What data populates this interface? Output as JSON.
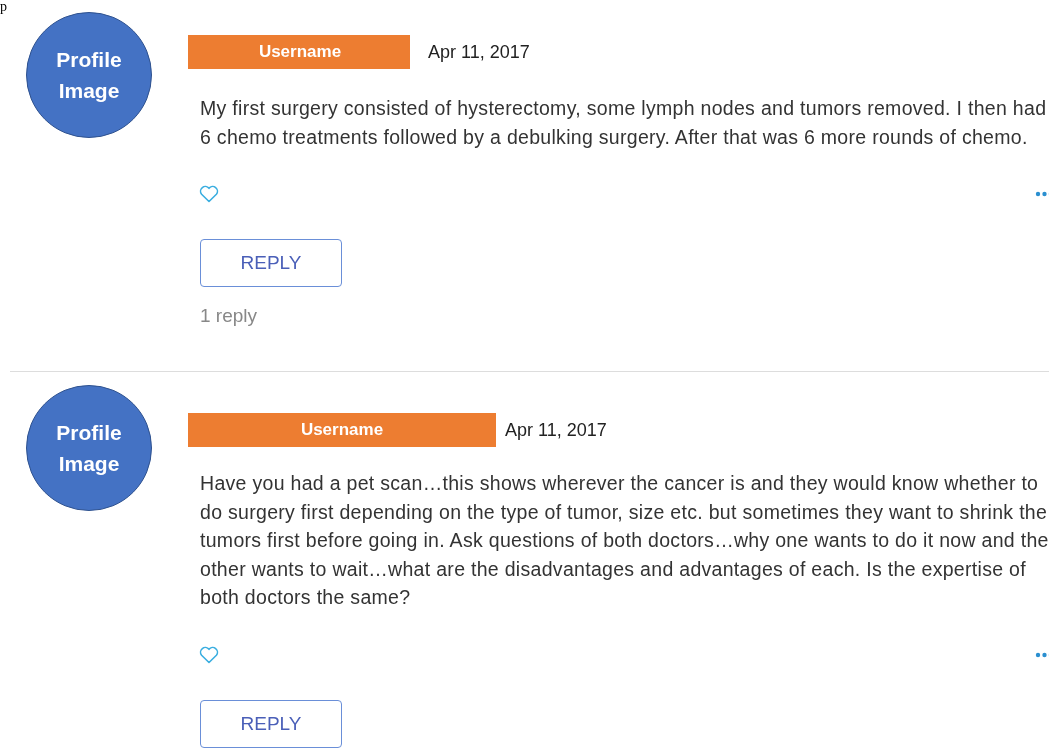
{
  "corner_text": "p",
  "comments": [
    {
      "avatar": "Profile Image",
      "username": "Username",
      "date": "Apr 11, 2017",
      "body": "My first surgery consisted of hysterectomy, some lymph nodes and tumors removed. I then had 6 chemo treatments followed by a debulking surgery. After that was 6 more rounds of chemo.",
      "liked": false,
      "reply_button": "REPLY",
      "reply_count": "1 reply"
    },
    {
      "avatar": "Profile Image",
      "username": "Username",
      "date": "Apr 11, 2017",
      "body": "Have you had a pet scan…this shows wherever the cancer is and they would know whether to do surgery first depending on the type of tumor, size etc. but sometimes they want to shrink the tumors first before going in. Ask questions of both doctors…why one wants to do it now and the other wants to wait…what are the disadvantages and advantages of each. Is the expertise of both doctors the same?",
      "liked": false,
      "reply_button": "REPLY"
    }
  ]
}
